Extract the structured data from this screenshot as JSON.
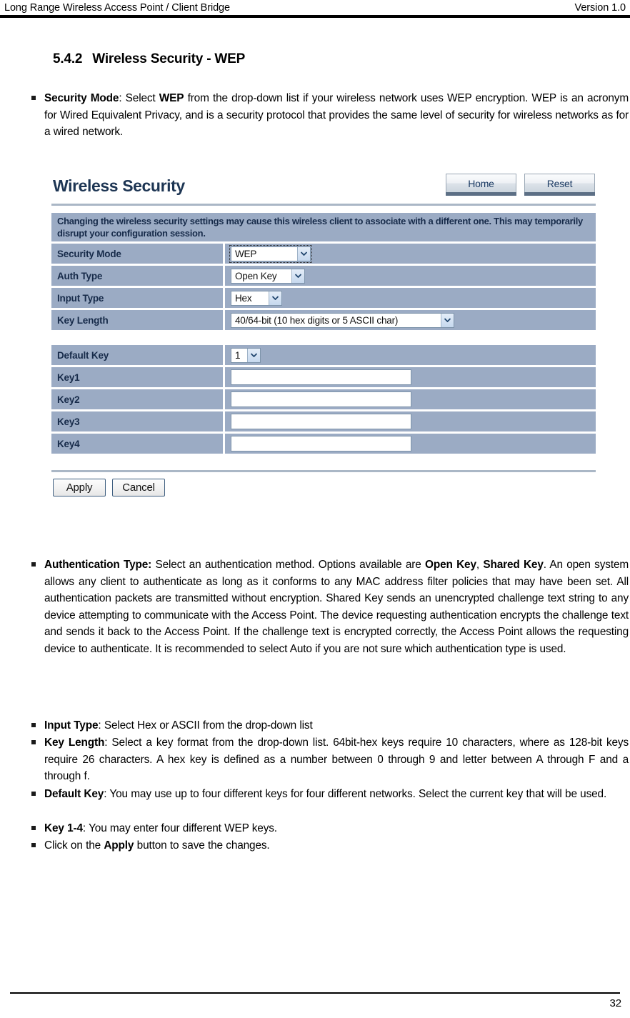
{
  "header": {
    "left_title": "Long Range Wireless Access Point / Client Bridge",
    "right_version": "Version 1.0"
  },
  "section": {
    "number": "5.4.2",
    "title": "Wireless Security - WEP"
  },
  "bullets": {
    "security_mode": {
      "term": "Security Mode",
      "html": "<b>Security Mode</b>: Select <b>WEP</b> from the drop-down list if your wireless network uses WEP encryption. WEP is an acronym for Wired Equivalent Privacy, and is a security protocol that provides the same level of security for wireless networks as for a wired network."
    },
    "auth_type": {
      "term": "Authentication Type:",
      "html": "<b>Authentication Type:</b> Select an authentication method. Options available are <b>Open Key</b>, <b>Shared Key</b>. An open system allows any client to authenticate as long as it conforms to any MAC address filter policies that may have been set. All authentication packets are transmitted without encryption. Shared Key sends an unencrypted challenge text string to any device attempting to communicate with the Access Point. The device requesting authentication encrypts the challenge text and sends it back to the Access Point. If the challenge text is encrypted correctly, the Access Point allows the requesting device to authenticate. It is recommended to select Auto if you are not sure which authentication type is used."
    },
    "input_type": {
      "term": "Input Type",
      "html": "<b>Input Type</b>: Select Hex or ASCII from the drop-down list"
    },
    "key_length": {
      "term": "Key Length",
      "html": "<b>Key Length</b>: Select a key format from the drop-down list. 64bit-hex keys require 10 characters, where as 128-bit keys require 26 characters. A hex key is defined as a number between 0 through 9 and letter between A through F and a through f."
    },
    "default_key": {
      "term": "Default Key",
      "html": "<b>Default Key</b>: You may use up to four different keys for four different networks. Select the current key that will be used."
    },
    "key_1_4": {
      "term": "Key 1-4",
      "html": "<b>Key 1-4</b>: You may enter four different WEP keys."
    },
    "apply_note": {
      "term": "Apply",
      "html": "Click on the <b>Apply</b> button to save the changes."
    }
  },
  "screenshot": {
    "panel_title": "Wireless Security",
    "nav_buttons": [
      {
        "label": "Home",
        "name": "home-button"
      },
      {
        "label": "Reset",
        "name": "reset-button"
      }
    ],
    "notice": "Changing the wireless security settings may cause this wireless client to associate with a different one. This may temporarily disrupt your configuration session.",
    "settings_rows": [
      {
        "label": "Security Mode",
        "control": "select",
        "value": "WEP"
      },
      {
        "label": "Auth Type",
        "control": "select",
        "value": "Open Key"
      },
      {
        "label": "Input Type",
        "control": "select",
        "value": "Hex"
      },
      {
        "label": "Key Length",
        "control": "select",
        "value": "40/64-bit (10 hex digits or 5 ASCII char)"
      }
    ],
    "key_rows": [
      {
        "label": "Default Key",
        "control": "select",
        "value": "1"
      },
      {
        "label": "Key1",
        "control": "text",
        "value": ""
      },
      {
        "label": "Key2",
        "control": "text",
        "value": ""
      },
      {
        "label": "Key3",
        "control": "text",
        "value": ""
      },
      {
        "label": "Key4",
        "control": "text",
        "value": ""
      }
    ],
    "actions": [
      {
        "label": "Apply",
        "name": "apply-button"
      },
      {
        "label": "Cancel",
        "name": "cancel-button"
      }
    ],
    "colors": {
      "row_bg": "#9babc4",
      "row_text": "#172b4a",
      "title_text": "#1d3553",
      "rule": "#aab7c6",
      "input_border": "#7e94ab"
    }
  },
  "footer": {
    "page_number": "32"
  }
}
